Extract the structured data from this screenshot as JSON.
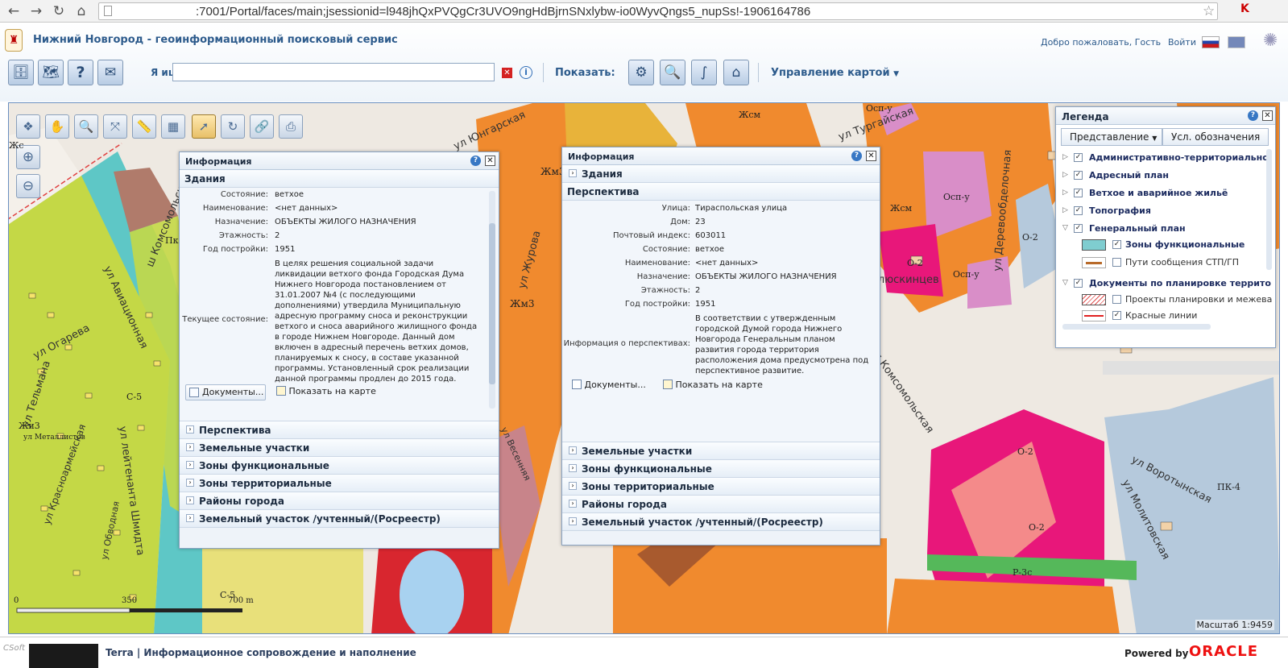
{
  "browser": {
    "url": ":7001/Portal/faces/main;jsessionid=l948jhQxPVQgCr3UVO9ngHdBjrnSNxlybw-io0WyvQngs5_nupSs!-1906164786"
  },
  "header": {
    "title": "Нижний Новгород - геоинформационный поисковый сервис",
    "welcome": "Добро пожаловать, Гость",
    "login": "Войти"
  },
  "toolbar": {
    "search_label": "Я ищу:",
    "search_value": "",
    "show_label": "Показать:",
    "map_management": "Управление картой"
  },
  "map": {
    "scale": "Масштаб 1:9459",
    "scalebar": {
      "start": "0",
      "mid": "350",
      "end": "700 m"
    },
    "streets": [
      {
        "text": "ул Огарева"
      },
      {
        "text": "ул Тельмана"
      },
      {
        "text": "ул Авиационная"
      },
      {
        "text": "ш Комсомольское"
      },
      {
        "text": "ул Красноармейская"
      },
      {
        "text": "ул лейтенанта Шмидта"
      },
      {
        "text": "ул Обводная"
      },
      {
        "text": "ул Журова"
      },
      {
        "text": "ул Тургайская"
      },
      {
        "text": "ул Деревообделочная"
      },
      {
        "text": "ул Комсомольская"
      },
      {
        "text": "ул Воротынская"
      },
      {
        "text": "ул Молитовская"
      },
      {
        "text": "ул Весенняя"
      },
      {
        "text": "Челюскинцев"
      },
      {
        "text": "ул Юнгарская"
      }
    ],
    "zones": [
      {
        "text": "Жсм"
      },
      {
        "text": "Осп-у"
      },
      {
        "text": "Осп-у"
      },
      {
        "text": "Жсм"
      },
      {
        "text": "О-2"
      },
      {
        "text": "Осп-у"
      },
      {
        "text": "О-2"
      },
      {
        "text": "Жм3"
      },
      {
        "text": "Жм3"
      },
      {
        "text": "С-5"
      },
      {
        "text": "Жи3"
      },
      {
        "text": "О-2"
      },
      {
        "text": "О-2"
      },
      {
        "text": "ПК-4"
      },
      {
        "text": "Р-3с"
      },
      {
        "text": "С-5"
      },
      {
        "text": "Жс"
      },
      {
        "text": "Пк"
      },
      {
        "text": "ул Металлистов"
      }
    ]
  },
  "info_left": {
    "title": "Информация",
    "section_open": "Здания",
    "fields": [
      {
        "k": "Состояние:",
        "v": "ветхое"
      },
      {
        "k": "Наименование:",
        "v": "<нет данных>"
      },
      {
        "k": "Назначение:",
        "v": "ОБЪЕКТЫ ЖИЛОГО НАЗНАЧЕНИЯ"
      },
      {
        "k": "Этажность:",
        "v": "2"
      },
      {
        "k": "Год постройки:",
        "v": "1951"
      }
    ],
    "current_state_label": "Текущее состояние:",
    "current_state_text": "В целях решения социальной задачи ликвидации ветхого фонда Городская Дума Нижнего Новгорода постановлением от 31.01.2007 №4 (с последующими дополнениями) утвердила Муниципальную адресную программу сноса и реконструкции ветхого и сноса аварийного жилищного фонда в городе Нижнем Новгороде. Данный дом включен в адресный перечень ветхих домов, планируемых к сносу, в составе указанной программы. Установленный срок реализации данной программы продлен до 2015 года.",
    "docs_button": "Документы...",
    "show_on_map": "Показать на карте",
    "sections": [
      "Перспектива",
      "Земельные участки",
      "Зоны функциональные",
      "Зоны территориальные",
      "Районы города",
      "Земельный участок /учтенный/(Росреестр)"
    ]
  },
  "info_right": {
    "title": "Информация",
    "section_top": "Здания",
    "section_open": "Перспектива",
    "fields": [
      {
        "k": "Улица:",
        "v": "Тираспольская улица"
      },
      {
        "k": "Дом:",
        "v": "23"
      },
      {
        "k": "Почтовый индекс:",
        "v": "603011"
      },
      {
        "k": "Состояние:",
        "v": "ветхое"
      },
      {
        "k": "Наименование:",
        "v": "<нет данных>"
      },
      {
        "k": "Назначение:",
        "v": "ОБЪЕКТЫ ЖИЛОГО НАЗНАЧЕНИЯ"
      },
      {
        "k": "Этажность:",
        "v": "2"
      },
      {
        "k": "Год постройки:",
        "v": "1951"
      }
    ],
    "perspective_label": "Информация о перспективах:",
    "perspective_text": "В соответствии с утвержденным городской Думой города Нижнего Новгорода Генеральным планом развития города территория расположения дома предусмотрена под перспективное развитие.",
    "docs_button": "Документы...",
    "show_on_map": "Показать на карте",
    "sections": [
      "Земельные участки",
      "Зоны функциональные",
      "Зоны территориальные",
      "Районы города",
      "Земельный участок /учтенный/(Росреестр)"
    ]
  },
  "legend": {
    "title": "Легенда",
    "tab_view": "Представление",
    "tab_symbols": "Усл. обозначения",
    "layers": [
      {
        "label": "Административно-территориально"
      },
      {
        "label": "Адресный план"
      },
      {
        "label": "Ветхое и аварийное жильё"
      },
      {
        "label": "Топография"
      },
      {
        "label": "Генеральный план"
      }
    ],
    "sublayers": [
      {
        "label": "Зоны функциональные",
        "checked": true,
        "color": "#7fcdd0"
      },
      {
        "label": "Пути сообщения СТП/ГП",
        "checked": false,
        "color": "#b86a2a"
      }
    ],
    "docs_layer": "Документы по планировке террито",
    "doc_sublayers": [
      {
        "label": "Проекты планировки и межева"
      },
      {
        "label": "Красные линии"
      }
    ]
  },
  "footer": {
    "csoft": "CSoft",
    "terra": "Terra",
    "text": "| Информационное сопровождение и наполнение",
    "powered": "Powered by",
    "oracle": "ORACLE"
  }
}
